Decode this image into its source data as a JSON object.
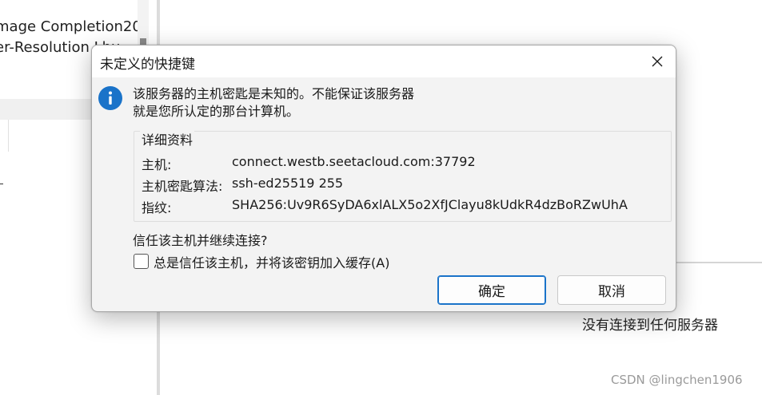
{
  "background": {
    "list_items": [
      "mage Completion20",
      "er-Resolution Lhu"
    ],
    "status_text": "没有连接到任何服务器",
    "watermark": "CSDN @lingchen1906"
  },
  "dialog": {
    "title": "未定义的快捷键",
    "message_line1": "该服务器的主机密匙是未知的。不能保证该服务器",
    "message_line2": "就是您所认定的那台计算机。",
    "details_title": "详细资料",
    "details": [
      {
        "label": "主机:",
        "value": "connect.westb.seetacloud.com:37792"
      },
      {
        "label": "主机密匙算法:",
        "value": "ssh-ed25519 255"
      },
      {
        "label": "指纹:",
        "value": "SHA256:Uv9R6SyDA6xlALX5o2XfJClayu8kUdkR4dzBoRZwUhA"
      }
    ],
    "question": "信任该主机并继续连接?",
    "checkbox_label": "总是信任该主机，并将该密钥加入缓存(A)",
    "checkbox_checked": false,
    "ok_label": "确定",
    "cancel_label": "取消",
    "icons": {
      "info": "info-icon",
      "close": "close-icon"
    },
    "accent_color": "#1a73c9"
  }
}
